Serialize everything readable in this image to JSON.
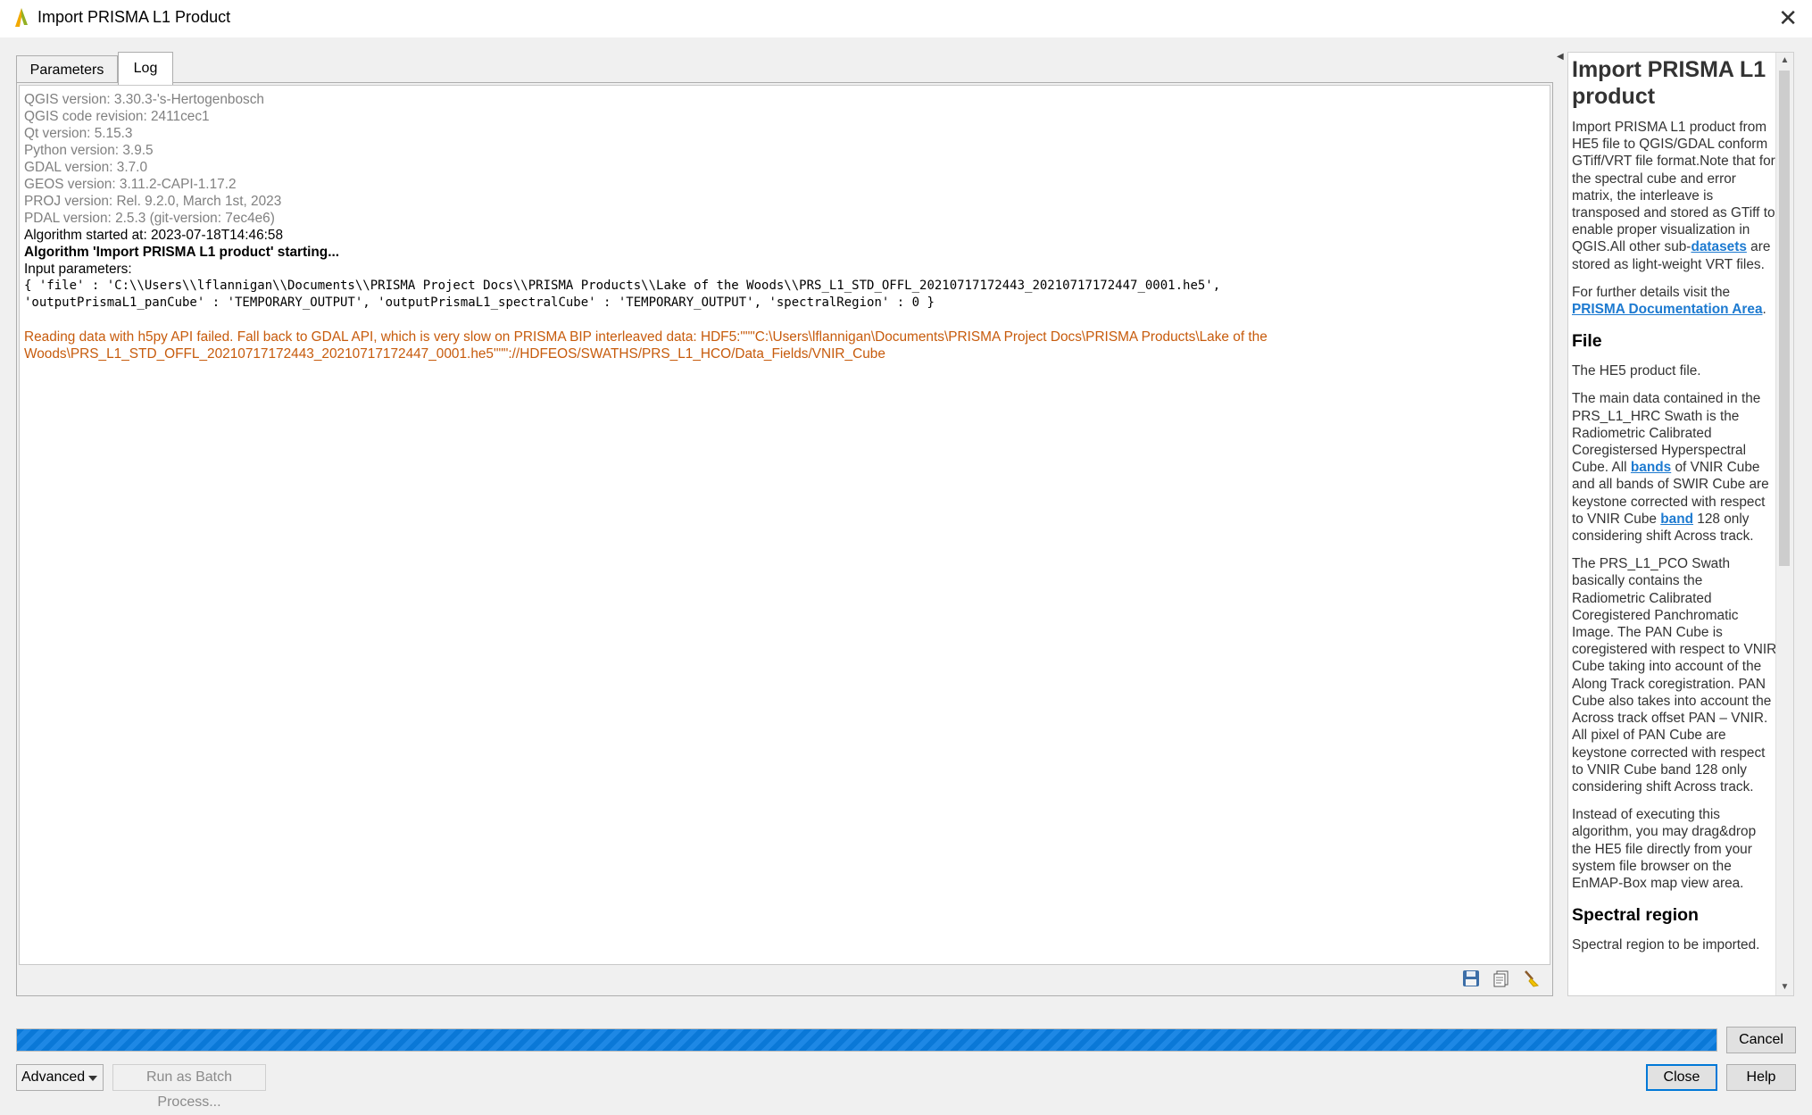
{
  "window": {
    "title": "Import PRISMA L1 Product",
    "close_glyph": "✕"
  },
  "tabs": [
    {
      "label": "Parameters",
      "active": false
    },
    {
      "label": "Log",
      "active": true
    }
  ],
  "log": {
    "version_lines": [
      "QGIS version: 3.30.3-'s-Hertogenbosch",
      "QGIS code revision: 2411cec1",
      "Qt version: 5.15.3",
      "Python version: 3.9.5",
      "GDAL version: 3.7.0",
      "GEOS version: 3.11.2-CAPI-1.17.2",
      "PROJ version: Rel. 9.2.0, March 1st, 2023",
      "PDAL version: 2.5.3 (git-version: 7ec4e6)"
    ],
    "started_at": "Algorithm started at: 2023-07-18T14:46:58",
    "starting": "Algorithm 'Import PRISMA L1 product' starting...",
    "input_params_label": "Input parameters:",
    "params_line1": "{ 'file' : 'C:\\\\Users\\\\lflannigan\\\\Documents\\\\PRISMA Project Docs\\\\PRISMA Products\\\\Lake of the Woods\\\\PRS_L1_STD_OFFL_20210717172443_20210717172447_0001.he5',",
    "params_line2": "'outputPrismaL1_panCube' : 'TEMPORARY_OUTPUT', 'outputPrismaL1_spectralCube' : 'TEMPORARY_OUTPUT', 'spectralRegion' : 0 }",
    "warning_line1": "Reading data with h5py API failed. Fall back to GDAL API, which is very slow on PRISMA BIP interleaved data: HDF5:\"\"\"C:\\Users\\lflannigan\\Documents\\PRISMA Project Docs\\PRISMA Products\\Lake of the",
    "warning_line2": "Woods\\PRS_L1_STD_OFFL_20210717172443_20210717172447_0001.he5\"\"\"://HDFEOS/SWATHS/PRS_L1_HCO/Data_Fields/VNIR_Cube",
    "warning_color": "#c75b0c",
    "tools": [
      "save-icon",
      "copy-icon",
      "clear-icon"
    ]
  },
  "help": {
    "title": "Import PRISMA L1 product",
    "intro_a": "Import PRISMA L1 product from HE5 file to QGIS/GDAL conform GTiff/VRT file format.Note that for the spectral cube and error matrix, the interleave is transposed and stored as GTiff to enable proper visualization in QGIS.All other sub-",
    "intro_link": "datasets",
    "intro_b": " are stored as light-weight VRT files.",
    "further_a": "For further details visit the ",
    "further_link": "PRISMA Documentation Area",
    "further_b": ".",
    "file_heading": "File",
    "file_p1": "The HE5 product file.",
    "file_p2_a": "The main data contained in the PRS_L1_HRC Swath is the Radiometric Calibrated Coregistersed Hyperspectral Cube. All ",
    "file_p2_link1": "bands",
    "file_p2_b": " of VNIR Cube and all bands of SWIR Cube are keystone corrected with respect to VNIR Cube ",
    "file_p2_link2": "band",
    "file_p2_c": " 128 only considering shift Across track.",
    "file_p3": "The PRS_L1_PCO Swath basically contains the Radiometric Calibrated Coregistered Panchromatic Image. The PAN Cube is coregistered with respect to VNIR Cube taking into account of the Along Track coregistration. PAN Cube also takes into account the Across track offset PAN – VNIR. All pixel of PAN Cube are keystone corrected with respect to VNIR Cube band 128 only considering shift Across track.",
    "file_p4": "Instead of executing this algorithm, you may drag&drop the HE5 file directly from your system file browser on the EnMAP-Box map view area.",
    "spectral_heading": "Spectral region",
    "spectral_p1": "Spectral region to be imported."
  },
  "progress": {
    "value": 1.0
  },
  "buttons": {
    "cancel": "Cancel",
    "advanced": "Advanced",
    "batch": "Run as Batch Process...",
    "close": "Close",
    "help": "Help"
  }
}
